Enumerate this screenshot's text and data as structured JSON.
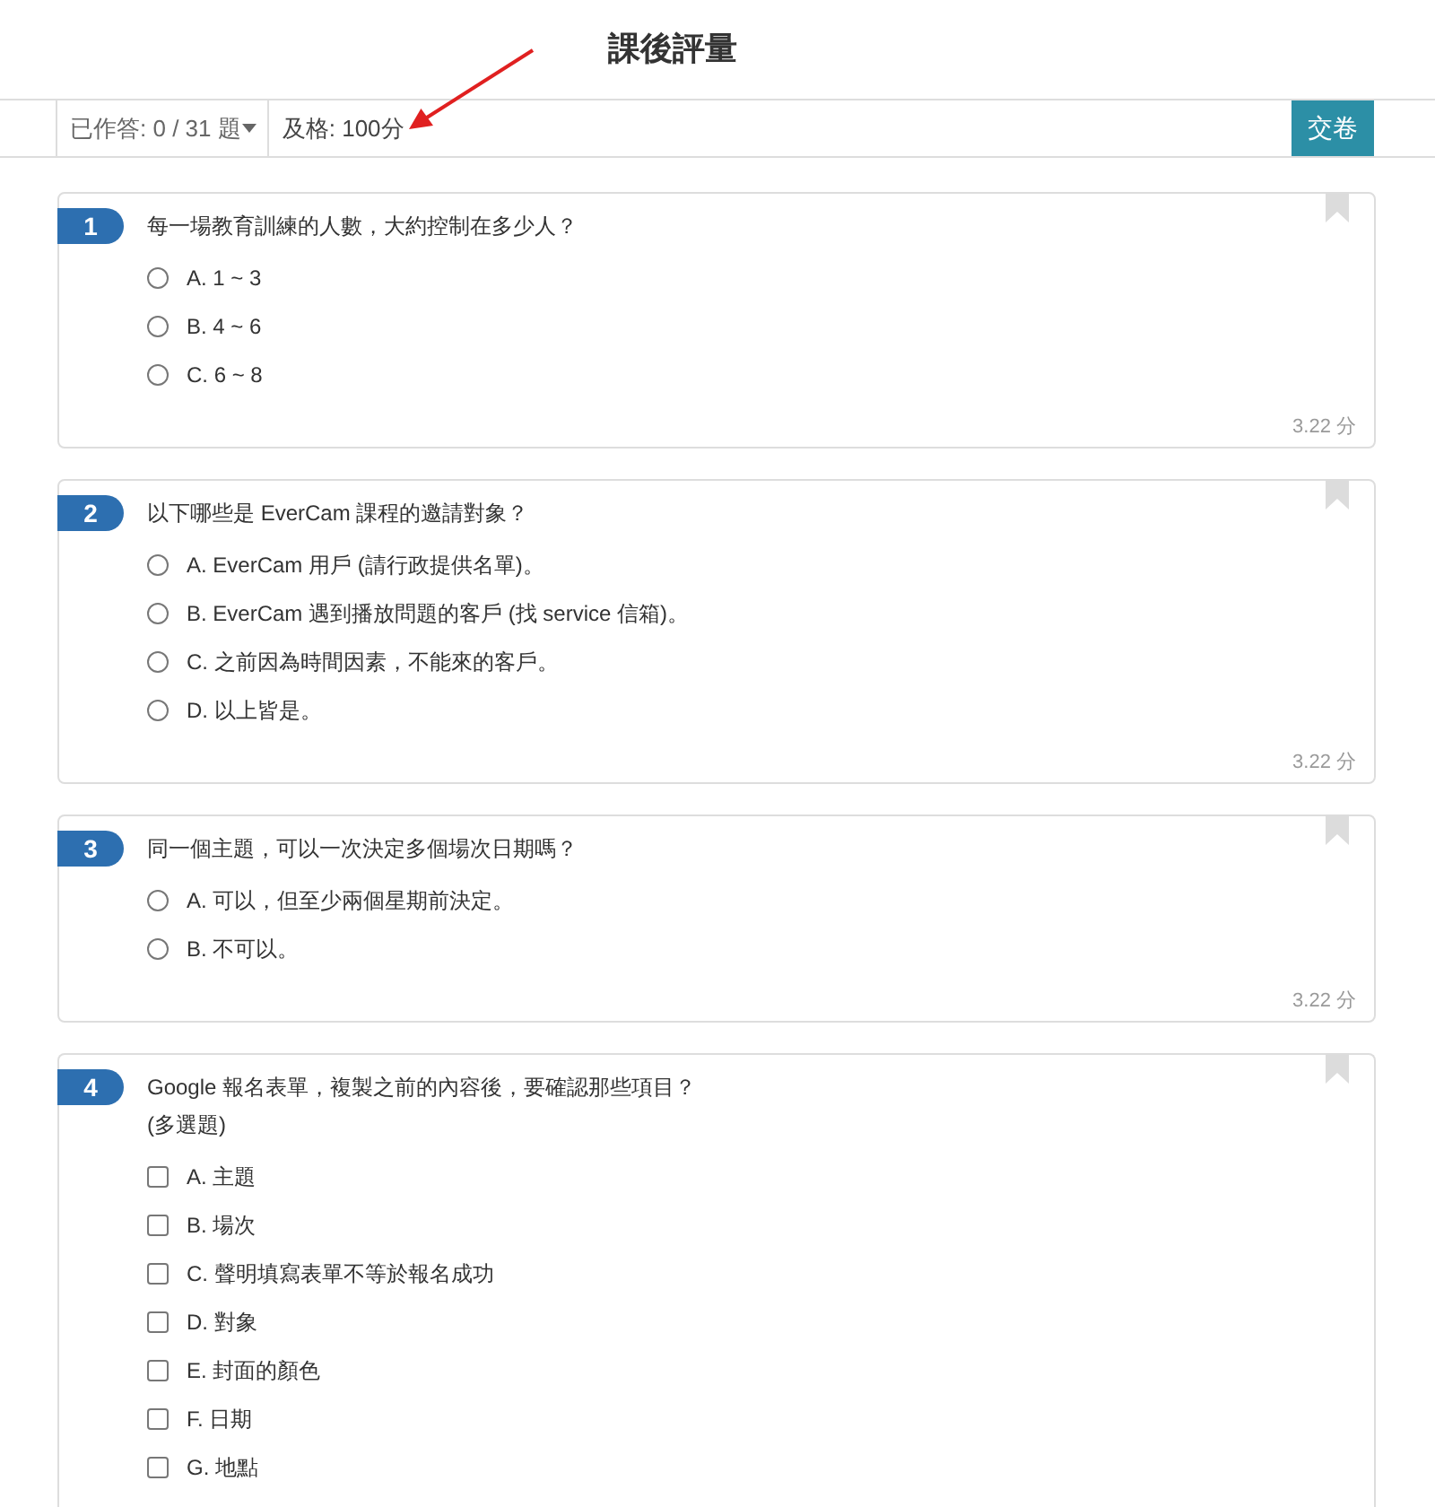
{
  "header": {
    "title": "課後評量"
  },
  "toolbar": {
    "answered": "已作答: 0 / 31 題",
    "passing": "及格: 100分",
    "submit": "交卷"
  },
  "questions": [
    {
      "number": "1",
      "text": "每一場教育訓練的人數，大約控制在多少人？",
      "kind": "single",
      "bookmarked": false,
      "options": [
        {
          "label": "A. 1 ~ 3",
          "selected": false
        },
        {
          "label": "B. 4 ~ 6",
          "selected": false
        },
        {
          "label": "C. 6 ~ 8",
          "selected": false
        }
      ],
      "score": "3.22 分"
    },
    {
      "number": "2",
      "text": "以下哪些是 EverCam 課程的邀請對象？",
      "kind": "single",
      "bookmarked": false,
      "options": [
        {
          "label": "A. EverCam 用戶 (請行政提供名單)。",
          "selected": false
        },
        {
          "label": "B. EverCam 遇到播放問題的客戶 (找 service 信箱)。",
          "selected": false
        },
        {
          "label": "C. 之前因為時間因素，不能來的客戶。",
          "selected": false
        },
        {
          "label": "D. 以上皆是。",
          "selected": false
        }
      ],
      "score": "3.22 分"
    },
    {
      "number": "3",
      "text": "同一個主題，可以一次決定多個場次日期嗎？",
      "kind": "single",
      "bookmarked": false,
      "options": [
        {
          "label": "A. 可以，但至少兩個星期前決定。",
          "selected": false
        },
        {
          "label": "B. 不可以。",
          "selected": false
        }
      ],
      "score": "3.22 分"
    },
    {
      "number": "4",
      "text": "Google 報名表單，複製之前的內容後，要確認那些項目？",
      "note": "(多選題)",
      "kind": "multiple",
      "bookmarked": false,
      "options": [
        {
          "label": "A. 主題",
          "checked": false
        },
        {
          "label": "B. 場次",
          "checked": false
        },
        {
          "label": "C. 聲明填寫表單不等於報名成功",
          "checked": false
        },
        {
          "label": "D. 對象",
          "checked": false
        },
        {
          "label": "E. 封面的顏色",
          "checked": false
        },
        {
          "label": "F. 日期",
          "checked": false
        },
        {
          "label": "G. 地點",
          "checked": false
        }
      ]
    }
  ]
}
